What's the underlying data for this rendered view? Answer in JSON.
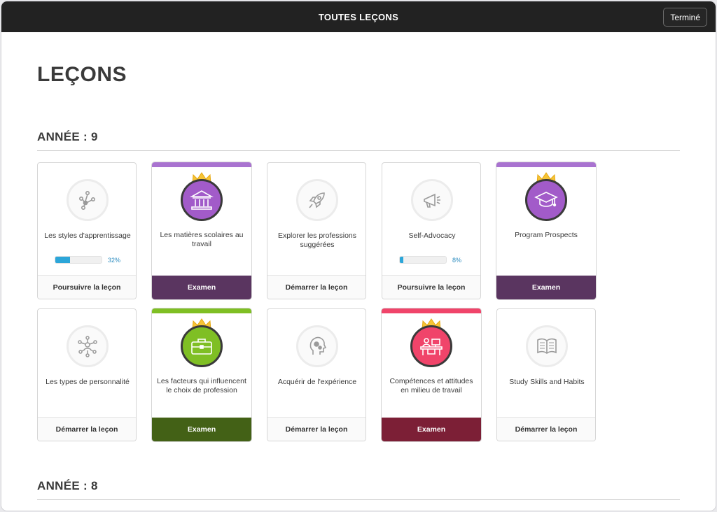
{
  "topbar": {
    "title": "TOUTES LEÇONS",
    "done_label": "Terminé"
  },
  "page": {
    "title": "LEÇONS"
  },
  "colors": {
    "purple": "#a25bc9",
    "purple_dark": "#5a3560",
    "purple_strip": "#a973d0",
    "green": "#7fbf24",
    "green_dark": "#436116",
    "pink": "#f0446a",
    "pink_dark": "#7c1f36",
    "crown": "#f6c436"
  },
  "sections": [
    {
      "title": "ANNÉE : 9",
      "cards": [
        {
          "label": "Les styles d'apprentissage",
          "icon": "network-nodes-icon",
          "progress": 0.32,
          "progress_label": "32%",
          "footer": "Poursuivre la leçon"
        },
        {
          "label": "Les matières scolaires au travail",
          "icon": "bank-building-icon",
          "footer": "Examen",
          "theme": "purple"
        },
        {
          "label": "Explorer les professions suggérées",
          "icon": "rocket-icon",
          "footer": "Démarrer la leçon"
        },
        {
          "label": "Self-Advocacy",
          "icon": "megaphone-icon",
          "progress": 0.08,
          "progress_label": "8%",
          "footer": "Poursuivre la leçon"
        },
        {
          "label": "Program Prospects",
          "icon": "graduation-cap-icon",
          "footer": "Examen",
          "theme": "purple"
        },
        {
          "label": "Les types de personnalité",
          "icon": "people-network-icon",
          "footer": "Démarrer la leçon"
        },
        {
          "label": "Les facteurs qui influencent le choix de profession",
          "icon": "briefcase-icon",
          "footer": "Examen",
          "theme": "green"
        },
        {
          "label": "Acquérir de l'expérience",
          "icon": "head-gears-icon",
          "footer": "Démarrer la leçon"
        },
        {
          "label": "Compétences et attitudes en milieu de travail",
          "icon": "office-desk-icon",
          "footer": "Examen",
          "theme": "pink"
        },
        {
          "label": "Study Skills and Habits",
          "icon": "open-book-icon",
          "footer": "Démarrer la leçon"
        }
      ]
    },
    {
      "title": "ANNÉE : 8"
    }
  ]
}
